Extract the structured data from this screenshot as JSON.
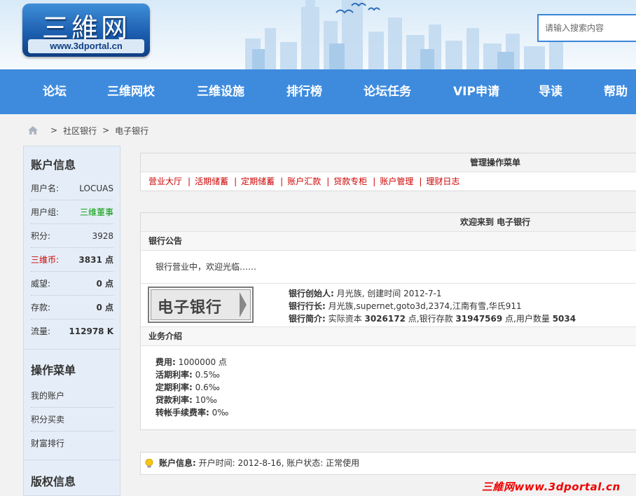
{
  "logo": {
    "main": "三維网",
    "sub": "www.3dportal.cn"
  },
  "search": {
    "placeholder": "请输入搜索内容"
  },
  "nav": [
    "论坛",
    "三维网校",
    "三维设施",
    "排行榜",
    "论坛任务",
    "VIP申请",
    "导读",
    "帮助"
  ],
  "breadcrumb": {
    "items": [
      "社区银行",
      "电子银行"
    ],
    "separator": ">"
  },
  "sidebar": {
    "account_title": "账户信息",
    "account_rows": [
      {
        "label": "用户名:",
        "value": "LOCUAS"
      },
      {
        "label": "用户组:",
        "value": "三维董事"
      },
      {
        "label": "积分:",
        "value": "3928"
      },
      {
        "label": "三维币:",
        "value": "3831 点"
      },
      {
        "label": "威望:",
        "value": "0 点"
      },
      {
        "label": "存款:",
        "value": "0 点"
      },
      {
        "label": "流量:",
        "value": "112978 K"
      }
    ],
    "menu_title": "操作菜单",
    "menu_items": [
      "我的账户",
      "积分买卖",
      "财富排行"
    ],
    "copyright_title": "版权信息"
  },
  "manage": {
    "title": "管理操作菜单",
    "links": [
      "营业大厅",
      "活期储蓄",
      "定期储蓄",
      "账户汇款",
      "贷款专柜",
      "账户管理",
      "理财日志"
    ]
  },
  "welcome": {
    "title": "欢迎来到 电子银行",
    "notice_title": "银行公告",
    "notice_text": "银行营业中，欢迎光临……",
    "bank_logo_text": "电子银行",
    "founder_label": "银行创始人:",
    "founder_value": "月光族, 创建时间 2012-7-1",
    "president_label": "银行行长:",
    "president_value": "月光族,supernet,goto3d,2374,江南有雪,华氏911",
    "intro_label": "银行简介:",
    "intro_t1": "实际资本",
    "capital": "3026172",
    "intro_t2": "点,银行存款",
    "deposits": "31947569",
    "intro_t3": "点,用户数量",
    "users": "5034",
    "business_title": "业务介绍",
    "business": [
      {
        "label": "费用:",
        "value": "1000000 点"
      },
      {
        "label": "活期利率:",
        "value": "0.5‰"
      },
      {
        "label": "定期利率:",
        "value": "0.6‰"
      },
      {
        "label": "贷款利率:",
        "value": "10‰"
      },
      {
        "label": "转帐手续费率:",
        "value": "0‰"
      }
    ]
  },
  "tip": {
    "label": "账户信息:",
    "text": "开户时间: 2012-8-16, 账户状态: 正常使用"
  },
  "watermark": "三維网www.3dportal.cn",
  "colors": {
    "nav_bg": "#3e8bde",
    "link_red": "#cc0000",
    "group_green": "#009900",
    "sidebar_bg": "#e5eef8"
  }
}
